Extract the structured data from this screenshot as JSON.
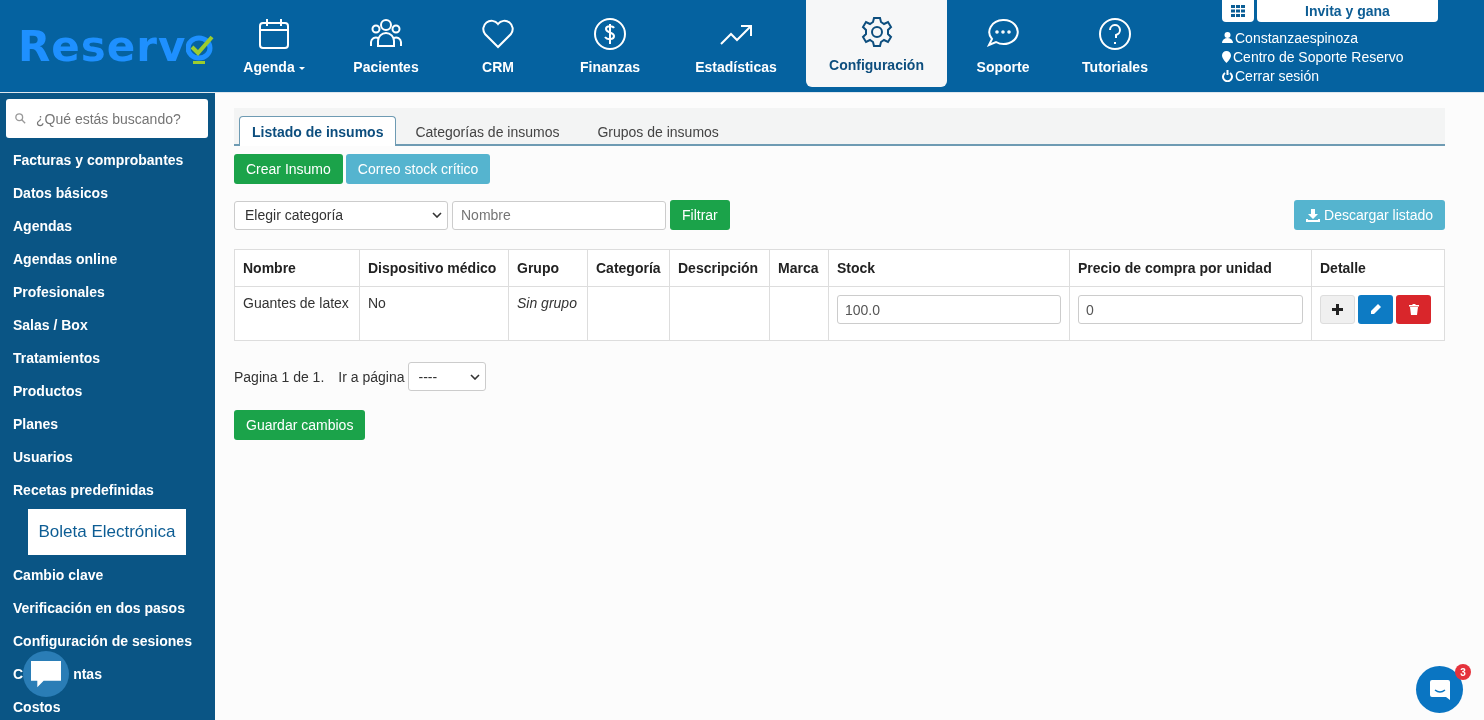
{
  "logo": {
    "text": "Reserv"
  },
  "nav": [
    {
      "label": "Agenda",
      "dropdown": true,
      "selected": false
    },
    {
      "label": "Pacientes",
      "dropdown": false,
      "selected": false
    },
    {
      "label": "CRM",
      "dropdown": false,
      "selected": false
    },
    {
      "label": "Finanzas",
      "dropdown": false,
      "selected": false
    },
    {
      "label": "Estadísticas",
      "dropdown": false,
      "selected": false
    },
    {
      "label": "Configuración",
      "dropdown": false,
      "selected": true
    },
    {
      "label": "Soporte",
      "dropdown": false,
      "selected": false
    },
    {
      "label": "Tutoriales",
      "dropdown": false,
      "selected": false
    }
  ],
  "account": {
    "invite": "Invita y gana",
    "user": "Constanzaespinoza",
    "support": "Centro de Soporte Reservo",
    "logout": "Cerrar sesión"
  },
  "sidebar": {
    "search_placeholder": "¿Qué estás buscando?",
    "items": [
      {
        "kind": "link",
        "label": "Facturas y comprobantes"
      },
      {
        "kind": "link",
        "label": "Datos básicos"
      },
      {
        "kind": "link",
        "label": "Agendas"
      },
      {
        "kind": "link",
        "label": "Agendas online"
      },
      {
        "kind": "link",
        "label": "Profesionales"
      },
      {
        "kind": "link",
        "label": "Salas / Box"
      },
      {
        "kind": "link",
        "label": "Tratamientos"
      },
      {
        "kind": "link",
        "label": "Productos"
      },
      {
        "kind": "link",
        "label": "Planes"
      },
      {
        "kind": "link",
        "label": "Usuarios"
      },
      {
        "kind": "link",
        "label": "Recetas predefinidas"
      },
      {
        "kind": "boxed",
        "label": "Boleta Electrónica"
      },
      {
        "kind": "link",
        "label": "Cambio clave"
      },
      {
        "kind": "link",
        "label": "Verificación en dos pasos"
      },
      {
        "kind": "link",
        "label": "Configuración de sesiones"
      },
      {
        "kind": "covered",
        "label_start": "C",
        "label_end": "ntas"
      },
      {
        "kind": "link",
        "label": "Costos"
      }
    ]
  },
  "tabs": [
    {
      "label": "Listado de insumos",
      "selected": true
    },
    {
      "label": "Categorías de insumos",
      "selected": false
    },
    {
      "label": "Grupos de insumos",
      "selected": false
    }
  ],
  "actions": {
    "create": "Crear Insumo",
    "mail": "Correo stock crítico"
  },
  "filters": {
    "category": "Elegir categoría",
    "name_placeholder": "Nombre",
    "filter": "Filtrar",
    "download": "Descargar listado"
  },
  "table": {
    "columns": [
      "Nombre",
      "Dispositivo médico",
      "Grupo",
      "Categoría",
      "Descripción",
      "Marca",
      "Stock",
      "Precio de compra por unidad",
      "Detalle"
    ],
    "rows": [
      {
        "nombre": "Guantes de latex",
        "dispositivo": "No",
        "grupo": "Sin grupo",
        "stock": "100.0",
        "precio": "0"
      }
    ]
  },
  "pagination": {
    "text": "Pagina 1 de 1.",
    "goto": "Ir a página",
    "page": "----"
  },
  "save": "Guardar cambios",
  "chat": {
    "badge": "3"
  }
}
